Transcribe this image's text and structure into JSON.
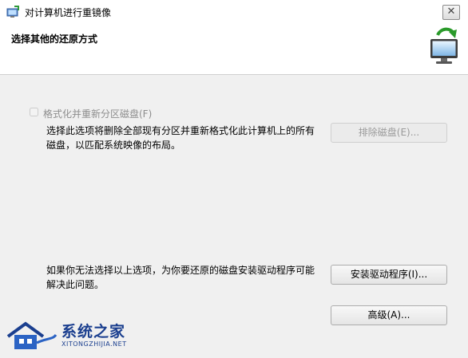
{
  "window": {
    "title": "对计算机进行重镜像",
    "close_glyph": "✕",
    "icon": "restore-app-icon"
  },
  "header": {
    "title": "选择其他的还原方式",
    "icon": "monitor-restore-icon"
  },
  "options": {
    "format_label": "格式化并重新分区磁盘(F)",
    "format_checked": false,
    "format_enabled": false,
    "format_description": "选择此选项将删除全部现有分区并重新格式化此计算机上的所有磁盘，以匹配系统映像的布局。",
    "exclude_button": "排除磁盘(E)...",
    "driver_description": "如果你无法选择以上选项，为你要还原的磁盘安装驱动程序可能解决此问题。",
    "install_driver_button": "安装驱动程序(I)...",
    "advanced_button": "高级(A)..."
  },
  "watermark": {
    "title": "系统之家",
    "subtitle": "XITONGZHIJIA.NET"
  }
}
